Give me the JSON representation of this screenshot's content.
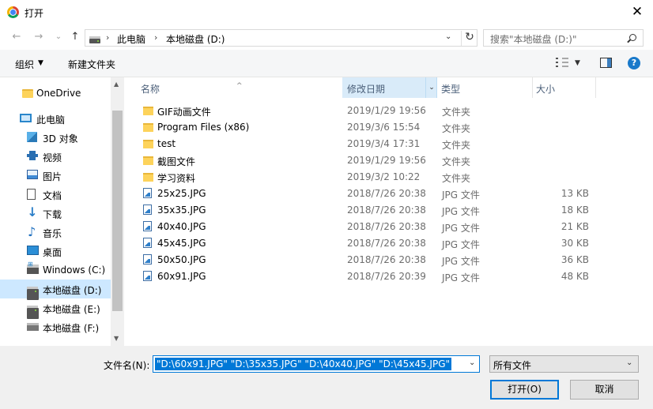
{
  "window": {
    "title": "打开",
    "close": "✕"
  },
  "nav": {
    "back": "←",
    "forward": "→",
    "recent": "⌄",
    "up": "↑"
  },
  "address": {
    "crumbs": [
      "此电脑",
      "本地磁盘 (D:)"
    ],
    "separator": "›",
    "dropdown": "⌄",
    "refresh": "↻"
  },
  "search": {
    "placeholder": "搜索\"本地磁盘 (D:)\""
  },
  "toolbar": {
    "organize": "组织",
    "organize_caret": "▼",
    "new_folder": "新建文件夹",
    "view_caret": "▼",
    "help": "?"
  },
  "sidebar": {
    "items": [
      {
        "label": "OneDrive",
        "icon": "folder-icon"
      },
      {
        "label": "此电脑",
        "icon": "computer-icon"
      },
      {
        "label": "3D 对象",
        "icon": "3d-objects-icon"
      },
      {
        "label": "视频",
        "icon": "video-icon"
      },
      {
        "label": "图片",
        "icon": "pictures-icon"
      },
      {
        "label": "文档",
        "icon": "documents-icon"
      },
      {
        "label": "下载",
        "icon": "download-icon"
      },
      {
        "label": "音乐",
        "icon": "music-icon"
      },
      {
        "label": "桌面",
        "icon": "desktop-icon"
      },
      {
        "label": "Windows (C:)",
        "icon": "windows-drive-icon"
      },
      {
        "label": "本地磁盘 (D:)",
        "icon": "drive-icon",
        "selected": true
      },
      {
        "label": "本地磁盘 (E:)",
        "icon": "drive-icon"
      },
      {
        "label": "本地磁盘 (F:)",
        "icon": "drive-icon"
      }
    ],
    "scroll_up": "▲",
    "scroll_down": "▼"
  },
  "columns": {
    "name": "名称",
    "modified": "修改日期",
    "type": "类型",
    "size": "大小",
    "sort_indicator": "^",
    "dropdown": "⌄"
  },
  "files": [
    {
      "name": "GIF动画文件",
      "modified": "2019/1/29 19:56",
      "type": "文件夹",
      "size": "",
      "kind": "folder"
    },
    {
      "name": "Program Files (x86)",
      "modified": "2019/3/6 15:54",
      "type": "文件夹",
      "size": "",
      "kind": "folder"
    },
    {
      "name": "test",
      "modified": "2019/3/4 17:31",
      "type": "文件夹",
      "size": "",
      "kind": "folder"
    },
    {
      "name": "截图文件",
      "modified": "2019/1/29 19:56",
      "type": "文件夹",
      "size": "",
      "kind": "folder"
    },
    {
      "name": "学习资料",
      "modified": "2019/3/2 10:22",
      "type": "文件夹",
      "size": "",
      "kind": "folder"
    },
    {
      "name": "25x25.JPG",
      "modified": "2018/7/26 20:38",
      "type": "JPG 文件",
      "size": "13 KB",
      "kind": "jpg"
    },
    {
      "name": "35x35.JPG",
      "modified": "2018/7/26 20:38",
      "type": "JPG 文件",
      "size": "18 KB",
      "kind": "jpg"
    },
    {
      "name": "40x40.JPG",
      "modified": "2018/7/26 20:38",
      "type": "JPG 文件",
      "size": "21 KB",
      "kind": "jpg"
    },
    {
      "name": "45x45.JPG",
      "modified": "2018/7/26 20:38",
      "type": "JPG 文件",
      "size": "30 KB",
      "kind": "jpg"
    },
    {
      "name": "50x50.JPG",
      "modified": "2018/7/26 20:38",
      "type": "JPG 文件",
      "size": "36 KB",
      "kind": "jpg"
    },
    {
      "name": "60x91.JPG",
      "modified": "2018/7/26 20:39",
      "type": "JPG 文件",
      "size": "48 KB",
      "kind": "jpg"
    }
  ],
  "footer": {
    "filename_label": "文件名(N):",
    "filename_value": "\"D:\\60x91.JPG\" \"D:\\35x35.JPG\" \"D:\\40x40.JPG\" \"D:\\45x45.JPG\"",
    "filename_dropdown": "⌄",
    "filetype_value": "所有文件",
    "filetype_dropdown": "⌄",
    "open_button": "打开(O)",
    "cancel_button": "取消"
  }
}
